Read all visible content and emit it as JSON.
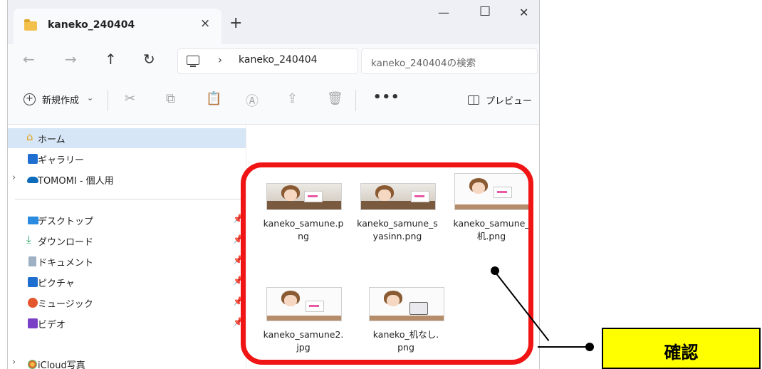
{
  "window": {
    "tab_title": "kaneko_240404",
    "tab_close": "×",
    "new_tab": "+",
    "minimize": "—",
    "maximize": "☐",
    "close": "✕"
  },
  "navbar": {
    "back": "←",
    "forward": "→",
    "up": "↑",
    "refresh": "↻",
    "breadcrumb_chevron": "›",
    "path": "kaneko_240404",
    "search_placeholder": "kaneko_240404の検索"
  },
  "commandbar": {
    "new_label": "新規作成",
    "new_caret": "⌄",
    "icons": [
      "scissors-icon",
      "copy-icon",
      "paste-icon",
      "rename-icon",
      "share-icon",
      "delete-icon"
    ],
    "more": "•••",
    "preview_label": "プレビュー"
  },
  "sidebar": {
    "items": [
      {
        "label": "ホーム",
        "icon": "home-icon",
        "selected": true
      },
      {
        "label": "ギャラリー",
        "icon": "gallery-icon"
      },
      {
        "label": "TOMOMI - 個人用",
        "icon": "onedrive-icon",
        "expander": "›"
      },
      {
        "label": "デスクトップ",
        "icon": "desktop-icon",
        "pin": "📌"
      },
      {
        "label": "ダウンロード",
        "icon": "download-icon",
        "pin": "📌"
      },
      {
        "label": "ドキュメント",
        "icon": "document-icon",
        "pin": "📌"
      },
      {
        "label": "ピクチャ",
        "icon": "pictures-icon",
        "pin": "📌"
      },
      {
        "label": "ミュージック",
        "icon": "music-icon",
        "pin": "📌"
      },
      {
        "label": "ビデオ",
        "icon": "video-icon",
        "pin": "📌"
      },
      {
        "label": "iCloud写真",
        "icon": "icloud-photos-icon",
        "expander": "›"
      }
    ]
  },
  "files": [
    {
      "name_line1": "kaneko_samune.p",
      "name_line2": "ng"
    },
    {
      "name_line1": "kaneko_samune_s",
      "name_line2": "yasinn.png"
    },
    {
      "name_line1": "kaneko_samune_",
      "name_line2": "机.png"
    },
    {
      "name_line1": "kaneko_samune2.",
      "name_line2": "jpg"
    },
    {
      "name_line1": "kaneko_机なし.",
      "name_line2": "png"
    }
  ],
  "callout": {
    "label": "確認",
    "box_color": "#ffff00",
    "frame_color": "#f01414"
  }
}
